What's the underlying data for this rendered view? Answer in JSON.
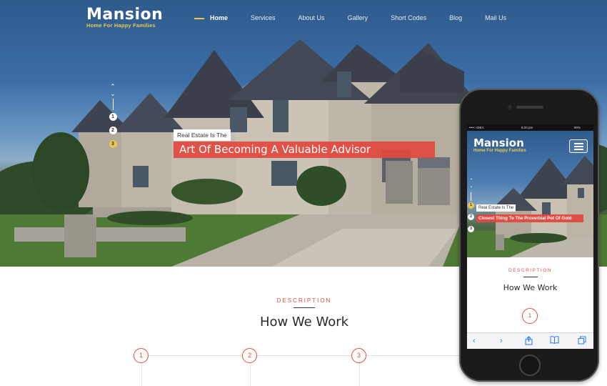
{
  "site": {
    "logo_title": "Mansion",
    "logo_tagline": "Home For Happy Families",
    "accent_color": "#e24b3e",
    "brand_yellow": "#e9c94b"
  },
  "nav": {
    "items": [
      {
        "label": "Home",
        "active": true
      },
      {
        "label": "Services"
      },
      {
        "label": "About Us"
      },
      {
        "label": "Gallery"
      },
      {
        "label": "Short Codes"
      },
      {
        "label": "Blog"
      },
      {
        "label": "Mail Us"
      }
    ]
  },
  "hero": {
    "slide_dots": [
      "1",
      "2",
      "3"
    ],
    "active_slide": "3",
    "caption_small": "Real Estate Is The",
    "caption_big": "Art Of Becoming A Valuable Advisor"
  },
  "section": {
    "eyebrow": "DESCRIPTION",
    "title": "How We Work",
    "steps": [
      "1",
      "2",
      "3"
    ]
  },
  "phone": {
    "status_carrier": "••••○ IDEA",
    "status_time": "8:20 pm",
    "status_battery": "90%",
    "logo_title": "Mansion",
    "logo_tagline": "Home For Happy Families",
    "slide_dots": [
      "1",
      "2",
      "3"
    ],
    "active_slide": "1",
    "caption_small": "Real Estate Is The",
    "caption_big": "Closest Thing To The Proverbial Pot Of Gold",
    "eyebrow": "DESCRIPTION",
    "title": "How We Work",
    "step": "1",
    "toolbar_icons": [
      "back-icon",
      "forward-icon",
      "share-icon",
      "bookmarks-icon",
      "tabs-icon"
    ]
  }
}
